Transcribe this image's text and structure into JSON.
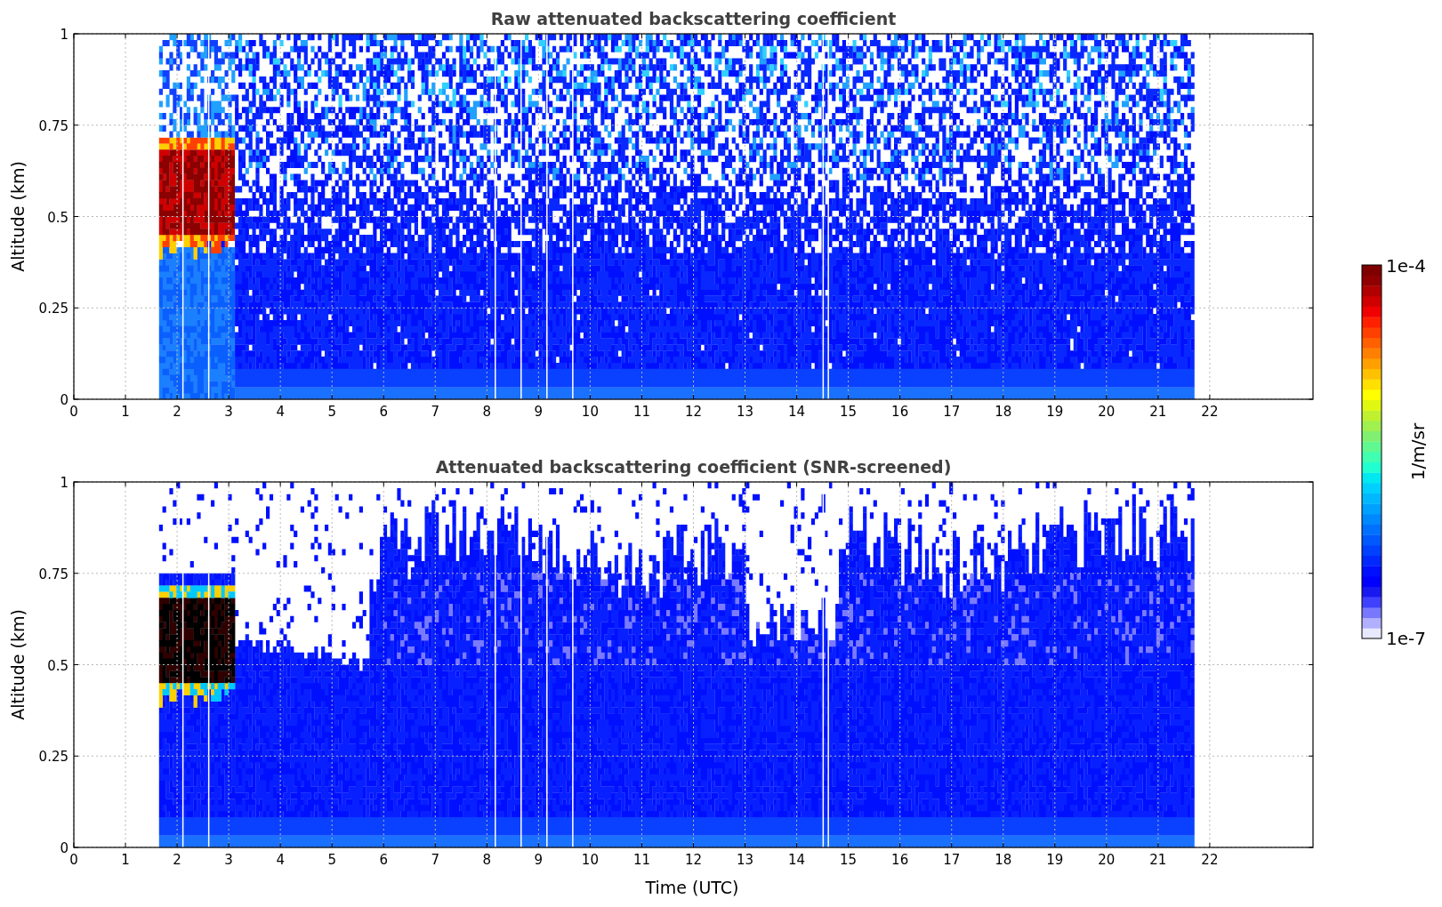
{
  "panels": [
    {
      "kind": "raw",
      "title": "Raw attenuated backscattering coefficient",
      "ylabel": "Altitude (km)",
      "yticks": [
        "1",
        "0.75",
        "0.5",
        "0.25",
        "0"
      ],
      "xticks": [
        "0",
        "1",
        "2",
        "3",
        "4",
        "5",
        "6",
        "7",
        "8",
        "9",
        "10",
        "11",
        "12",
        "13",
        "14",
        "15",
        "16",
        "17",
        "18",
        "19",
        "20",
        "21",
        "22"
      ]
    },
    {
      "kind": "screened",
      "title": "Attenuated backscattering coefficient (SNR-screened)",
      "ylabel": "Altitude (km)",
      "yticks": [
        "1",
        "0.75",
        "0.5",
        "0.25",
        "0"
      ],
      "xticks": [
        "0",
        "1",
        "2",
        "3",
        "4",
        "5",
        "6",
        "7",
        "8",
        "9",
        "10",
        "11",
        "12",
        "13",
        "14",
        "15",
        "16",
        "17",
        "18",
        "19",
        "20",
        "21",
        "22"
      ],
      "xlabel": "Time (UTC)"
    }
  ],
  "colorbar": {
    "max_label": "1e-4",
    "min_label": "1e-7",
    "label": "1/m/sr"
  }
}
